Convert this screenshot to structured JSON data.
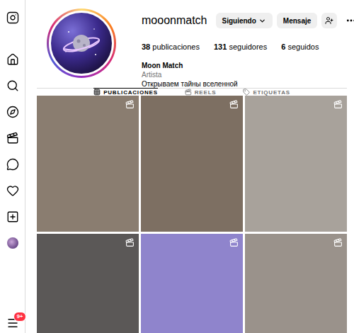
{
  "sidebar": {
    "badge": "9+"
  },
  "profile": {
    "username": "mooonmatch",
    "buttons": [
      {
        "label": "Siguiendo",
        "kind": "dropdown"
      },
      {
        "label": "Mensaje",
        "kind": "plain"
      }
    ],
    "stats": [
      {
        "count": "38",
        "label": "publicaciones"
      },
      {
        "count": "131",
        "label": "seguidores"
      },
      {
        "count": "6",
        "label": "seguidos"
      }
    ],
    "name": "Moon Match",
    "category": "Artista",
    "bio": "Открываем тайны вселенной"
  },
  "tabs": [
    {
      "label": "PUBLICACIONES",
      "selected": true,
      "kind": "grid"
    },
    {
      "label": "REELS",
      "selected": false,
      "kind": "reels"
    },
    {
      "label": "ETIQUETAS",
      "selected": false,
      "kind": "tag"
    }
  ],
  "posts": [
    {
      "kind": "reel",
      "color": "#8a7d70"
    },
    {
      "kind": "reel",
      "color": "#7d6f62"
    },
    {
      "kind": "reel",
      "color": "#a8a29b"
    },
    {
      "kind": "reel",
      "color": "#5b5857"
    },
    {
      "kind": "reel",
      "color": "#8f84cc"
    },
    {
      "kind": "reel",
      "color": "#9a928b"
    }
  ]
}
